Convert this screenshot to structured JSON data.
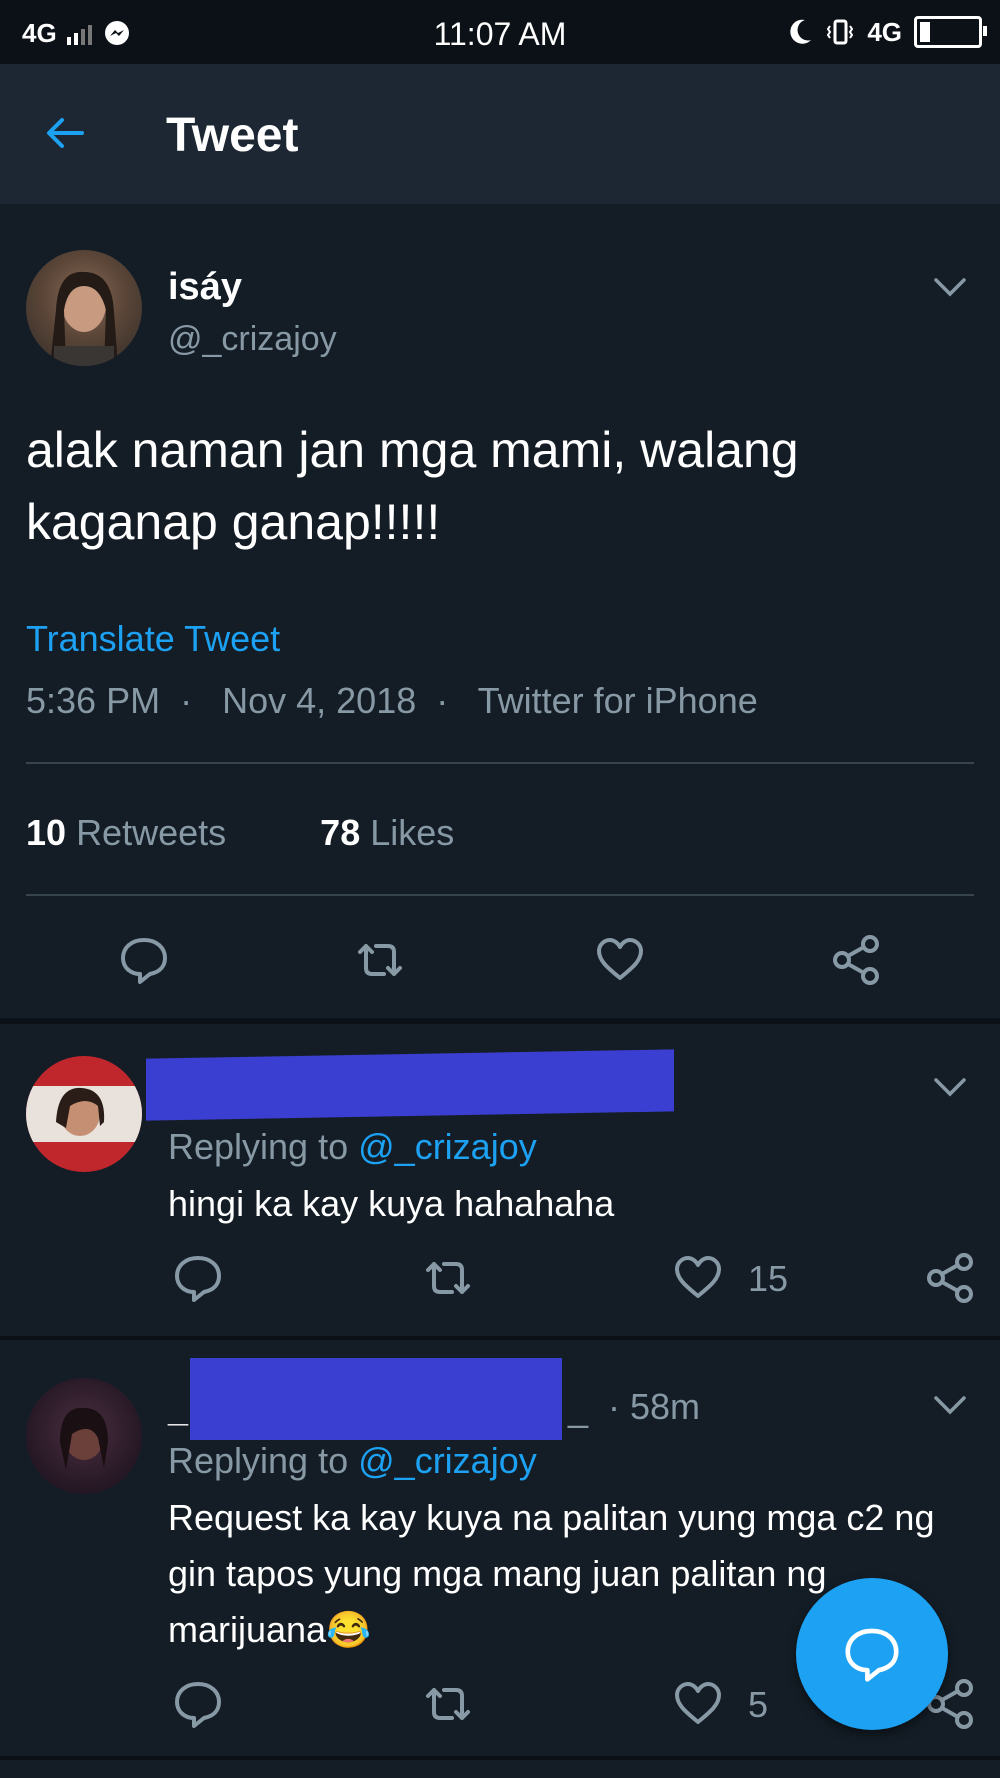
{
  "status_bar": {
    "network_left": "4G",
    "time": "11:07 AM",
    "network_right": "4G"
  },
  "header": {
    "title": "Tweet"
  },
  "tweet": {
    "author_name": "isáy",
    "author_handle": "@_crizajoy",
    "text": "alak naman jan mga mami, walang kaganap ganap!!!!!",
    "translate_label": "Translate Tweet",
    "time": "5:36 PM",
    "date": "Nov 4, 2018",
    "source": "Twitter for iPhone",
    "retweets_count": "10",
    "retweets_label": "Retweets",
    "likes_count": "78",
    "likes_label": "Likes"
  },
  "replies": [
    {
      "replying_prefix": "Replying to",
      "replying_handle": "@_crizajoy",
      "text": "hingi ka kay kuya hahahaha",
      "likes": "15"
    },
    {
      "name_prefix": "_",
      "name_suffix": "_",
      "age": "· 58m",
      "replying_prefix": "Replying to",
      "replying_handle": "@_crizajoy",
      "text": "Request ka kay kuya na palitan yung mga c2 ng gin tapos yung mga mang juan palitan ng marijuana😂",
      "likes": "5"
    }
  ],
  "colors": {
    "background": "#141d26",
    "header": "#1c2733",
    "accent": "#1da1f2",
    "muted": "#8899a6",
    "redaction": "#3b3fd1"
  },
  "icons": {
    "back": "arrow-left-icon",
    "reply": "speech-bubble-icon",
    "retweet": "retweet-icon",
    "like": "heart-icon",
    "share": "share-icon",
    "more": "chevron-down-icon",
    "compose": "compose-reply-icon"
  }
}
